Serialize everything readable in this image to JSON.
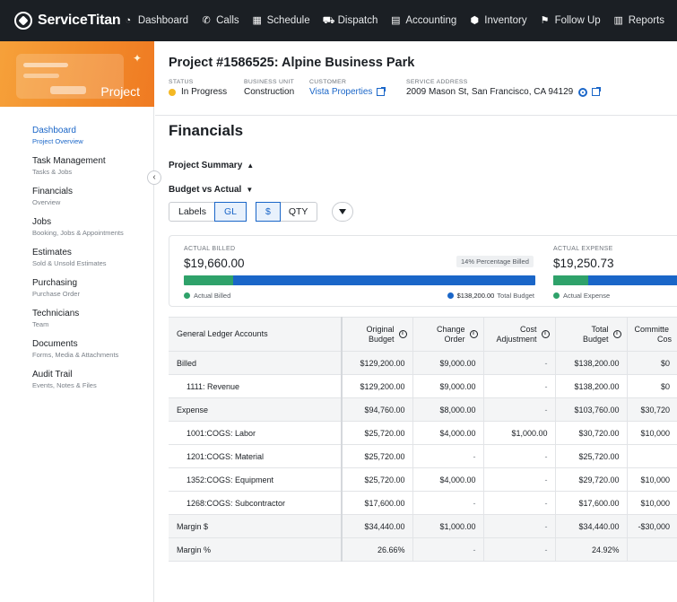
{
  "app": {
    "logo_text": "ServiceTitan",
    "nav": [
      {
        "label": "Dashboard",
        "icon": "dashboard-icon",
        "glyph": "◔"
      },
      {
        "label": "Calls",
        "icon": "phone-icon",
        "glyph": "✆"
      },
      {
        "label": "Schedule",
        "icon": "calendar-icon",
        "glyph": "▦"
      },
      {
        "label": "Dispatch",
        "icon": "truck-icon",
        "glyph": "⛟"
      },
      {
        "label": "Accounting",
        "icon": "ledger-icon",
        "glyph": "▤"
      },
      {
        "label": "Inventory",
        "icon": "box-icon",
        "glyph": "⬢"
      },
      {
        "label": "Follow Up",
        "icon": "flag-icon",
        "glyph": "⚑"
      },
      {
        "label": "Reports",
        "icon": "chart-icon",
        "glyph": "▥"
      }
    ]
  },
  "sidebar": {
    "banner_label": "Project",
    "items": [
      {
        "title": "Dashboard",
        "sub": "Project Overview",
        "active": true
      },
      {
        "title": "Task Management",
        "sub": "Tasks & Jobs"
      },
      {
        "title": "Financials",
        "sub": "Overview"
      },
      {
        "title": "Jobs",
        "sub": "Booking, Jobs & Appointments"
      },
      {
        "title": "Estimates",
        "sub": "Sold & Unsold Estimates"
      },
      {
        "title": "Purchasing",
        "sub": "Purchase Order"
      },
      {
        "title": "Technicians",
        "sub": "Team"
      },
      {
        "title": "Documents",
        "sub": "Forms, Media & Attachments"
      },
      {
        "title": "Audit Trail",
        "sub": "Events, Notes & Files"
      }
    ]
  },
  "project": {
    "title": "Project #1586525: Alpine Business Park",
    "status_label": "STATUS",
    "status": "In Progress",
    "unit_label": "BUSINESS UNIT",
    "unit": "Construction",
    "customer_label": "CUSTOMER",
    "customer": "Vista Properties",
    "address_label": "SERVICE ADDRESS",
    "address": "2009 Mason St, San Francisco, CA 94129"
  },
  "financials": {
    "title": "Financials",
    "project_summary": "Project Summary",
    "budget_vs_actual": "Budget vs Actual",
    "toggle_labels": "Labels",
    "toggle_gl": "GL",
    "toggle_dollar": "$",
    "toggle_qty": "QTY"
  },
  "summary": {
    "billed_label": "ACTUAL BILLED",
    "billed_value": "$19,660.00",
    "billed_pct_text": "14% Percentage Billed",
    "billed_fraction": 0.14,
    "billed_legend": "Actual Billed",
    "total_budget_value": "$138,200.00",
    "total_budget_label": "Total Budget",
    "expense_label": "ACTUAL EXPENSE",
    "expense_value": "$19,250.73",
    "expense_legend": "Actual Expense",
    "colors": {
      "actual": "#2fa26a",
      "budget": "#1a66c8"
    }
  },
  "table": {
    "headers": {
      "account": "General Ledger Accounts",
      "orig1": "Original",
      "orig2": "Budget",
      "change1": "Change",
      "change2": "Order",
      "cost1": "Cost",
      "cost2": "Adjustment",
      "total1": "Total",
      "total2": "Budget",
      "committed1": "Committe",
      "committed2": "Cos"
    },
    "rows": [
      {
        "name": "Billed",
        "group": true,
        "c": [
          "$129,200.00",
          "$9,000.00",
          "-",
          "$138,200.00",
          "$0"
        ]
      },
      {
        "name": "1111: Revenue",
        "group": false,
        "c": [
          "$129,200.00",
          "$9,000.00",
          "-",
          "$138,200.00",
          "$0"
        ]
      },
      {
        "name": "Expense",
        "group": true,
        "c": [
          "$94,760.00",
          "$8,000.00",
          "-",
          "$103,760.00",
          "$30,720"
        ]
      },
      {
        "name": "1001:COGS: Labor",
        "group": false,
        "c": [
          "$25,720.00",
          "$4,000.00",
          "$1,000.00",
          "$30,720.00",
          "$10,000"
        ]
      },
      {
        "name": "1201:COGS: Material",
        "group": false,
        "c": [
          "$25,720.00",
          "-",
          "-",
          "$25,720.00",
          ""
        ]
      },
      {
        "name": "1352:COGS: Equipment",
        "group": false,
        "c": [
          "$25,720.00",
          "$4,000.00",
          "-",
          "$29,720.00",
          "$10,000"
        ]
      },
      {
        "name": "1268:COGS: Subcontractor",
        "group": false,
        "c": [
          "$17,600.00",
          "-",
          "-",
          "$17,600.00",
          "$10,000"
        ]
      },
      {
        "name": "Margin $",
        "group": true,
        "c": [
          "$34,440.00",
          "$1,000.00",
          "-",
          "$34,440.00",
          "-$30,000"
        ]
      },
      {
        "name": "Margin %",
        "group": true,
        "c": [
          "26.66%",
          "-",
          "-",
          "24.92%",
          ""
        ]
      }
    ]
  }
}
